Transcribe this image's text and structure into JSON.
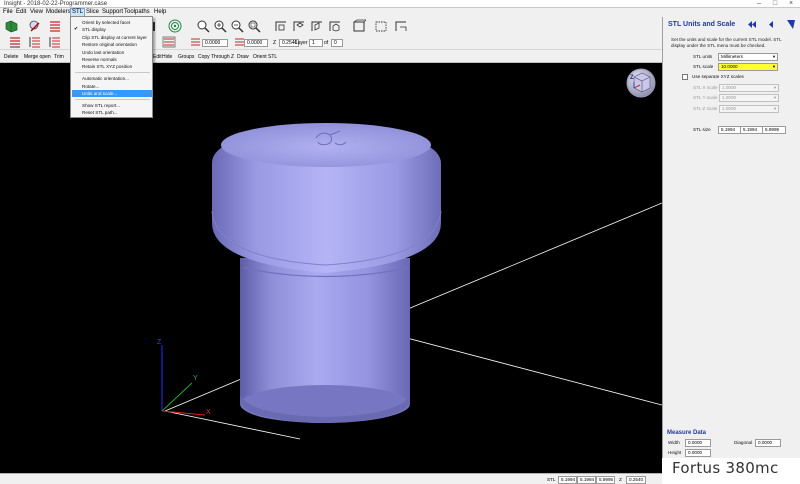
{
  "window": {
    "title": "Insight - 2018-02-22-Programmer.case"
  },
  "menubar": {
    "items": [
      "File",
      "Edit",
      "View",
      "Modelers",
      "STL",
      "Slice",
      "Support",
      "Toolpaths",
      "Help"
    ]
  },
  "stl_menu": {
    "items": [
      {
        "label": "Orient by selected facet"
      },
      {
        "label": "STL display",
        "checked": true
      },
      {
        "label": "Clip STL display at current layer"
      },
      {
        "label": "Restore original orientation"
      },
      {
        "label": "Undo last orientation"
      },
      {
        "label": "Reverse normals"
      },
      {
        "label": "Retain STL XYZ position"
      },
      {
        "label": "Automatic orientation..."
      },
      {
        "label": "Rotate..."
      },
      {
        "label": "Units and scale...",
        "highlighted": true
      },
      {
        "label": "Show STL report..."
      },
      {
        "label": "Reset STL path..."
      }
    ]
  },
  "toolbar2": {
    "value1": "0.0000",
    "value2": "0.0000",
    "z_label": "Z",
    "z_value": "0.2540",
    "layer_label": "Layer",
    "layer_value": "1",
    "of_label": "of",
    "of_value": "0"
  },
  "toolbar3": {
    "items": [
      "Delete",
      "Merge open",
      "Trim",
      "Edit",
      "Hide",
      "Groups",
      "Copy Through Z",
      "Draw",
      "Orient STL"
    ]
  },
  "axes": {
    "z": "Z",
    "y": "Y",
    "x": "X",
    "cube_label": "Z"
  },
  "panel": {
    "title": "STL Units and Scale",
    "description": "Set the units and scale for the current STL model. STL display under the STL menu must be checked.",
    "stl_units_label": "STL units",
    "stl_units_value": "Millimeters",
    "stl_scale_label": "STL scale",
    "stl_scale_value": "10.0000",
    "separate_label": "Use separate XYZ scales",
    "x_scale_label": "STL X scale",
    "x_scale_value": "1.0000",
    "y_scale_label": "STL Y scale",
    "y_scale_value": "1.0000",
    "z_scale_label": "STL Z scale",
    "z_scale_value": "1.0000",
    "stl_size_label": "STL size",
    "size_x": "5.1994",
    "size_y": "5.1994",
    "size_z": "5.9995",
    "measure_title": "Measure Data",
    "width_label": "Width",
    "width_value": "0.0000",
    "diagonal_label": "Diagonal",
    "diagonal_value": "0.0000",
    "height_label": "Height",
    "height_value": "0.0000"
  },
  "statusbar": {
    "stl_label": "STL",
    "v1": "5.1994",
    "v2": "5.1994",
    "v3": "5.9995",
    "z_label": "Z",
    "z_value": "0.2540"
  },
  "brand": {
    "text": "Fortus 380mc"
  },
  "colors": {
    "panel_title": "#1f3a9a",
    "model": "#9a9ae6",
    "scale_highlight": "#ffff33",
    "menu_highlight": "#3399ff"
  }
}
